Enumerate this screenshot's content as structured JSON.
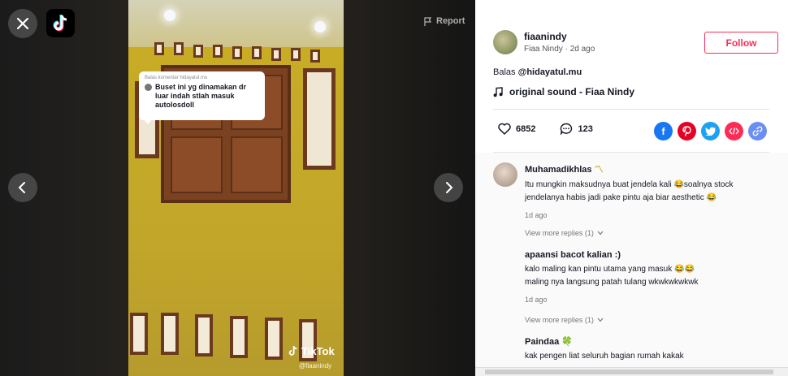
{
  "video": {
    "report_label": "Report",
    "bubble": {
      "header": "Balas komentar hidayatul.mu",
      "text": "Buset ini yg dinamakan dr luar indah stlah masuk autolosdoll"
    },
    "watermark_brand": "TikTok",
    "watermark_user": "@fiaanindy"
  },
  "post": {
    "username": "fiaanindy",
    "display_name": "Fiaa Nindy",
    "separator": "·",
    "time_ago": "2d ago",
    "follow_label": "Follow",
    "caption_prefix": "Balas",
    "caption_mention": "@hidayatul.mu",
    "music": "original sound - Fiaa Nindy",
    "likes": "6852",
    "comments": "123"
  },
  "share_colors": {
    "facebook": "#1877f2",
    "pinterest": "#e60023",
    "twitter": "#1da1f2",
    "embed": "#fe2c55",
    "link": "#6b8ef5"
  },
  "comments": [
    {
      "name": "Muhamadikhlas",
      "lines": [
        "Itu mungkin maksudnya buat jendela kali 😂soalnya stock",
        "jendelanya habis jadi pake pintu aja biar aesthetic 😂"
      ],
      "time": "1d ago",
      "view_more": "View more replies (1)"
    },
    {
      "name": "apaansi bacot kalian :)",
      "lines": [
        "kalo maling kan pintu utama yang masuk 😂😂",
        "maling nya langsung patah tulang wkwkwkwkwk"
      ],
      "time": "1d ago",
      "view_more": "View more replies (1)"
    },
    {
      "name": "Paindaa",
      "lines": [
        "kak pengen liat seluruh bagian rumah kakak"
      ],
      "time": "",
      "view_more": ""
    }
  ]
}
